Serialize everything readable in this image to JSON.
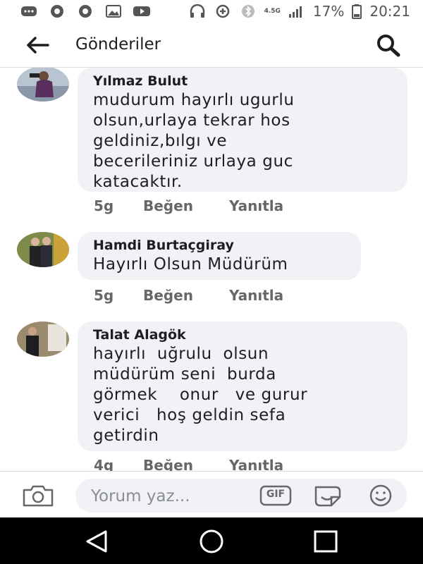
{
  "status_bar": {
    "network_label": "4.5G",
    "battery": "17%",
    "time": "20:21"
  },
  "header": {
    "title": "Gönderiler"
  },
  "comments": [
    {
      "author": "Yılmaz Bulut",
      "text": "mudurum hayırlı ugurlu\nolsun,urlaya tekrar hos\ngeldiniz,bılgı ve\nbecerileriniz urlaya guc\nkatacaktır.",
      "time": "5g",
      "like_label": "Beğen",
      "reply_label": "Yanıtla"
    },
    {
      "author": "Hamdi Burtaçgiray",
      "text": "Hayırlı Olsun Müdürüm",
      "time": "5g",
      "like_label": "Beğen",
      "reply_label": "Yanıtla"
    },
    {
      "author": "Talat Alagök",
      "text": "hayırlı  uğrulu  olsun\nmüdürüm seni  burda\ngörmek    onur   ve gurur\nverici   hoş geldin sefa\ngetirdin",
      "time": "4g",
      "like_label": "Beğen",
      "reply_label": "Yanıtla"
    }
  ],
  "composer": {
    "placeholder": "Yorum yaz...",
    "gif_label": "GIF"
  },
  "icons": {
    "back": "arrow-left-icon",
    "search": "search-icon",
    "camera": "camera-icon",
    "gif": "gif-icon",
    "sticker": "sticker-icon",
    "emoji": "emoji-icon"
  },
  "colors": {
    "bubble": "#f0f2f5",
    "secondary_text": "#65676b",
    "navbar": "#000000"
  }
}
